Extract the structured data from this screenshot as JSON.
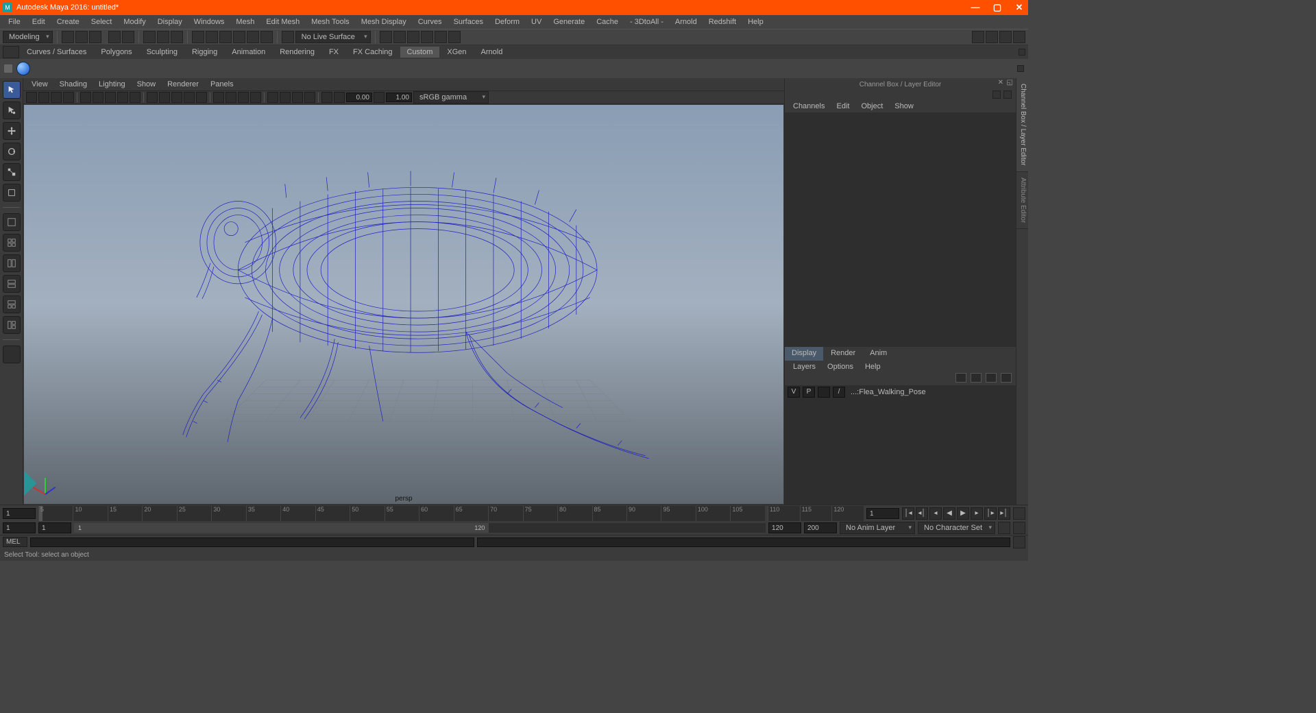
{
  "window": {
    "title": "Autodesk Maya 2016: untitled*"
  },
  "main_menu": [
    "File",
    "Edit",
    "Create",
    "Select",
    "Modify",
    "Display",
    "Windows",
    "Mesh",
    "Edit Mesh",
    "Mesh Tools",
    "Mesh Display",
    "Curves",
    "Surfaces",
    "Deform",
    "UV",
    "Generate",
    "Cache",
    "- 3DtoAll -",
    "Arnold",
    "Redshift",
    "Help"
  ],
  "workspace_dd": "Modeling",
  "live_surface": "No Live Surface",
  "shelf_tabs": [
    "Curves / Surfaces",
    "Polygons",
    "Sculpting",
    "Rigging",
    "Animation",
    "Rendering",
    "FX",
    "FX Caching",
    "Custom",
    "XGen",
    "Arnold"
  ],
  "shelf_active": "Custom",
  "panel_menu": [
    "View",
    "Shading",
    "Lighting",
    "Show",
    "Renderer",
    "Panels"
  ],
  "view_fields": {
    "a": "0.00",
    "b": "1.00"
  },
  "colorspace": "sRGB gamma",
  "persp_label": "persp",
  "channel_box": {
    "title": "Channel Box / Layer Editor",
    "menus": [
      "Channels",
      "Edit",
      "Object",
      "Show"
    ],
    "tabs": [
      "Display",
      "Render",
      "Anim"
    ],
    "tab_active": "Display",
    "layer_menus": [
      "Layers",
      "Options",
      "Help"
    ],
    "layer_row": {
      "v": "V",
      "p": "P",
      "slash": "/",
      "name": "...:Flea_Walking_Pose"
    }
  },
  "side_tabs": [
    "Channel Box / Layer Editor",
    "Attribute Editor"
  ],
  "side_active_index": 0,
  "time": {
    "current": "1",
    "start": "1",
    "end": "120",
    "range_start": "1",
    "range_end": "120",
    "anim_start": "120",
    "anim_end": "200",
    "ticks": [
      5,
      10,
      15,
      20,
      25,
      30,
      35,
      40,
      45,
      50,
      55,
      60,
      65,
      70,
      75,
      80,
      85,
      90,
      95,
      100,
      105
    ],
    "ticks_right": [
      110,
      115,
      120
    ],
    "anim_layer": "No Anim Layer",
    "char_set": "No Character Set"
  },
  "cmd_lang": "MEL",
  "helpline": "Select Tool: select an object"
}
